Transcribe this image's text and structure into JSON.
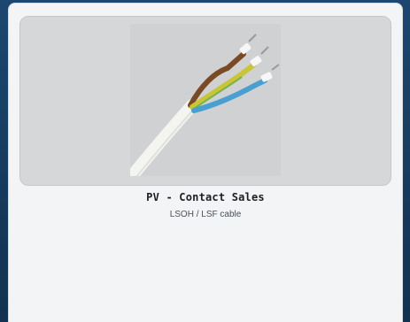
{
  "product": {
    "title": "PV - Contact Sales",
    "subtitle": "LSOH / LSF cable",
    "image_icon": "cable-photo-icon"
  }
}
